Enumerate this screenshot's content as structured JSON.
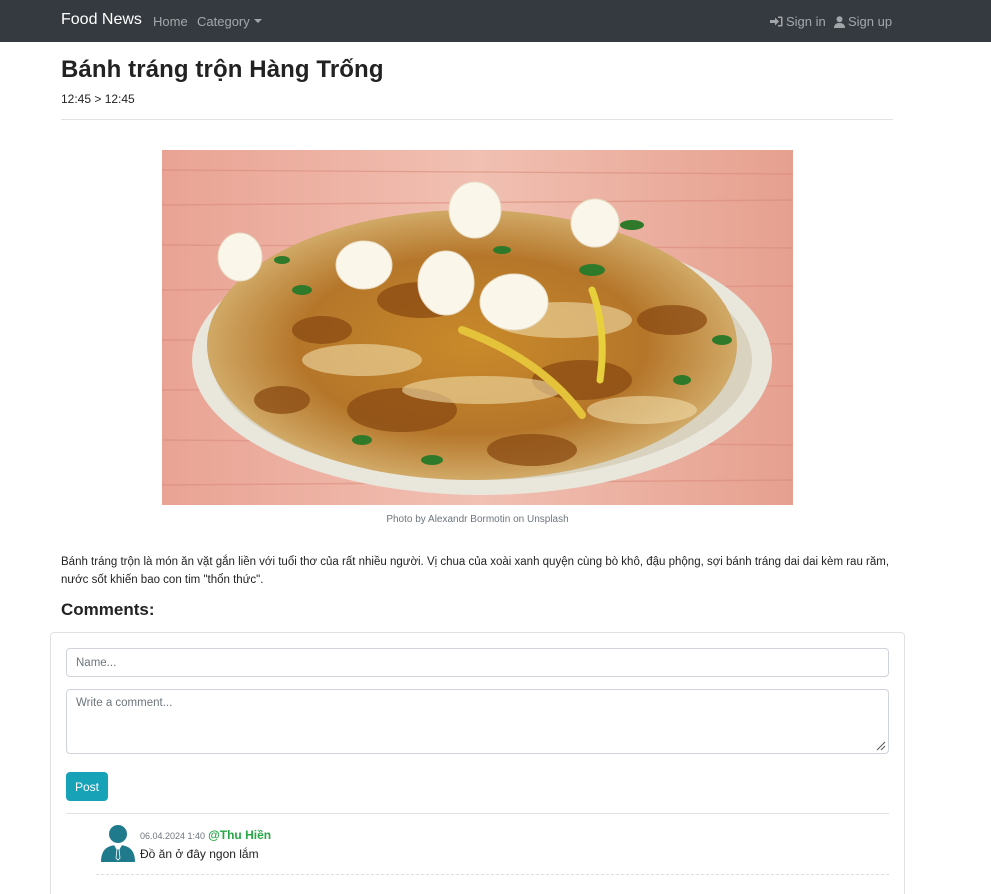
{
  "navbar": {
    "brand": "Food News",
    "home": "Home",
    "category": "Category",
    "sign_in": "Sign in",
    "sign_up": "Sign up"
  },
  "article": {
    "title": "Bánh tráng trộn Hàng Trống",
    "time": "12:45 > 12:45",
    "image_caption": "Photo by Alexandr Bormotin on Unsplash",
    "description": "Bánh tráng trộn là món ăn vặt gắn liền với tuổi thơ của rất nhiều người. Vị chua của xoài xanh quyện cùng bò khô, đậu phộng, sợi bánh tráng dai dai kèm rau răm, nước sốt khiến bao con tim \"thổn thức\"."
  },
  "comments": {
    "heading": "Comments:",
    "name_placeholder": "Name...",
    "comment_placeholder": "Write a comment...",
    "post_label": "Post",
    "items": [
      {
        "date": "06.04.2024 1:40",
        "user": "@Thu Hiền",
        "text": "Đồ ăn ở đây ngon lắm"
      }
    ]
  },
  "colors": {
    "navbar_bg": "#343a40",
    "post_button": "#17a2b8",
    "username": "#28a745",
    "avatar": "#1f7a8c"
  }
}
